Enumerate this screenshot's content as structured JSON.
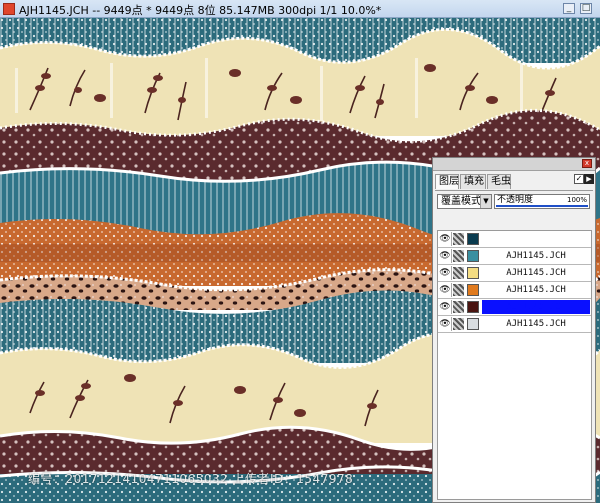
{
  "window": {
    "title": "AJH1145.JCH -- 9449点 * 9449点 8位  85.147MB 300dpi 1/1  10.0%*",
    "min_label": "_",
    "max_label": "□"
  },
  "watermark": "编号：20171214104711065032 上传者ID：1547978",
  "colors": {
    "teal": "#2c6b7c",
    "orange": "#c8692f",
    "cream": "#efe3b6",
    "maroon": "#5a2a2e",
    "selection": "#0a10ff"
  },
  "layers_panel": {
    "close_label": "x",
    "tabs": [
      "图层",
      "填充",
      "毛虫"
    ],
    "checkbox": "✓",
    "menu_arrow": "▶",
    "blend_mode": "覆盖模式",
    "blend_arrow": "▼",
    "opacity_label": "不透明度",
    "opacity_value": "100%",
    "layers": [
      {
        "visible_icon": "👁",
        "color": "#0a3b4f",
        "name": "",
        "selected": false
      },
      {
        "visible_icon": "👁",
        "color": "#3a8fa0",
        "name": "AJH1145.JCH",
        "selected": false
      },
      {
        "visible_icon": "👁",
        "color": "#f3dc82",
        "name": "AJH1145.JCH",
        "selected": false
      },
      {
        "visible_icon": "👁",
        "color": "#e07a1e",
        "name": "AJH1145.JCH",
        "selected": false
      },
      {
        "visible_icon": "👁",
        "color": "#4a1410",
        "name": "AJH1145.JCH",
        "selected": true
      },
      {
        "visible_icon": "👁",
        "color": "#d9dde0",
        "name": "AJH1145.JCH",
        "selected": false
      }
    ]
  }
}
